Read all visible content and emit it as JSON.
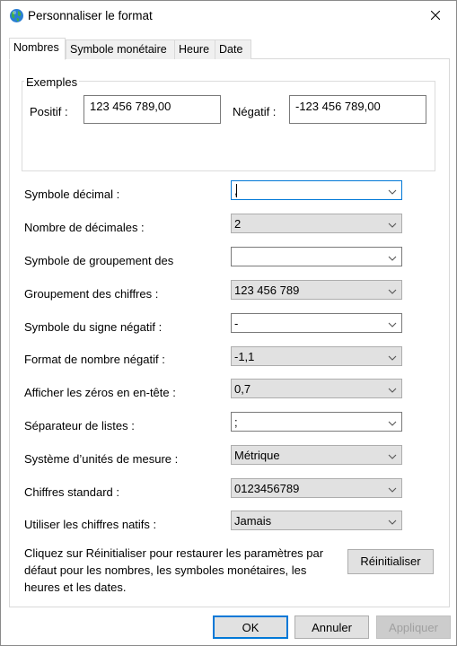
{
  "window": {
    "title": "Personnaliser le format",
    "icon": "globe-icon",
    "close_icon": "close-icon"
  },
  "tabs": [
    {
      "label": "Nombres",
      "active": true
    },
    {
      "label": "Symbole monétaire",
      "active": false
    },
    {
      "label": "Heure",
      "active": false
    },
    {
      "label": "Date",
      "active": false
    }
  ],
  "examples": {
    "group_label": "Exemples",
    "positive_label": "Positif :",
    "positive_value": "123 456 789,00",
    "negative_label": "Négatif :",
    "negative_value": "-123 456 789,00"
  },
  "settings": [
    {
      "label": "Symbole décimal :",
      "value": ",",
      "editable": true,
      "focused": true
    },
    {
      "label": "Nombre de décimales :",
      "value": "2",
      "editable": false
    },
    {
      "label": "Symbole de groupement des",
      "value": " ",
      "editable": true
    },
    {
      "label": "Groupement des chiffres :",
      "value": "123 456 789",
      "editable": false
    },
    {
      "label": "Symbole du signe négatif :",
      "value": "-",
      "editable": true
    },
    {
      "label": "Format de nombre négatif :",
      "value": "-1,1",
      "editable": false
    },
    {
      "label": "Afficher les zéros en en-tête :",
      "value": "0,7",
      "editable": false
    },
    {
      "label": "Séparateur de listes :",
      "value": ";",
      "editable": true
    },
    {
      "label": "Système d’unités de mesure :",
      "value": "Métrique",
      "editable": false
    },
    {
      "label": "Chiffres standard :",
      "value": "0123456789",
      "editable": false
    },
    {
      "label": "Utiliser les chiffres natifs :",
      "value": "Jamais",
      "editable": false
    }
  ],
  "reset": {
    "info_text": "Cliquez sur Réinitialiser pour restaurer les paramètres par défaut pour les nombres, les symboles monétaires, les heures et les dates.",
    "button_label": "Réinitialiser"
  },
  "buttons": {
    "ok": "OK",
    "cancel": "Annuler",
    "apply": "Appliquer"
  },
  "colors": {
    "accent": "#0078d7",
    "combo_bg": "#e1e1e1",
    "border": "#adadad"
  }
}
